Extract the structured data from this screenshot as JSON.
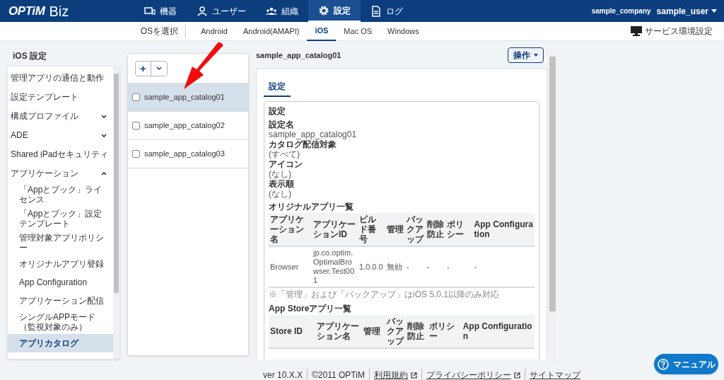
{
  "header": {
    "brand": "OPTiM",
    "product": "Biz",
    "nav": [
      {
        "label": "機器",
        "selected": false
      },
      {
        "label": "ユーザー",
        "selected": false
      },
      {
        "label": "組織",
        "selected": false
      },
      {
        "label": "設定",
        "selected": true
      },
      {
        "label": "ログ",
        "selected": false
      }
    ],
    "company": "sample_company",
    "user": "sample_user"
  },
  "os_bar": {
    "label": "OSを選択",
    "tabs": [
      {
        "label": "Android",
        "selected": false
      },
      {
        "label": "Android(AMAPI)",
        "selected": false
      },
      {
        "label": "iOS",
        "selected": true
      },
      {
        "label": "Mac OS",
        "selected": false
      },
      {
        "label": "Windows",
        "selected": false
      }
    ],
    "service_link": "サービス環境設定"
  },
  "sidebar": {
    "title": "iOS 設定",
    "items": [
      {
        "label": "管理アプリの通信と動作",
        "kind": "link",
        "selected": false
      },
      {
        "label": "設定テンプレート",
        "kind": "link",
        "selected": false
      },
      {
        "label": "構成プロファイル",
        "kind": "group",
        "expanded": false,
        "selected": false
      },
      {
        "label": "ADE",
        "kind": "group",
        "expanded": false,
        "selected": false
      },
      {
        "label": "Shared iPadセキュリティ",
        "kind": "link",
        "selected": false
      },
      {
        "label": "アプリケーション",
        "kind": "group",
        "expanded": true,
        "selected": false,
        "children": [
          {
            "label": "「Appとブック」ライセンス",
            "selected": false
          },
          {
            "label": "「Appとブック」設定テンプレート",
            "selected": false
          },
          {
            "label": "管理対象アプリポリシー",
            "selected": false
          },
          {
            "label": "オリジナルアプリ登録",
            "selected": false
          },
          {
            "label": "App Configuration",
            "selected": false
          },
          {
            "label": "アプリケーション配信",
            "selected": false
          },
          {
            "label": "シングルAPPモード（監視対象のみ）",
            "selected": false
          },
          {
            "label": "アプリカタログ",
            "selected": true
          }
        ]
      }
    ]
  },
  "catalog_list": {
    "add_button": "+",
    "items": [
      {
        "name": "sample_app_catalog01",
        "checked": false,
        "selected": true
      },
      {
        "name": "sample_app_catalog02",
        "checked": false,
        "selected": false
      },
      {
        "name": "sample_app_catalog03",
        "checked": false,
        "selected": false
      }
    ]
  },
  "detail": {
    "title": "sample_app_catalog01",
    "action_button": "操作",
    "tabs": [
      {
        "label": "設定",
        "selected": true
      }
    ],
    "section": {
      "heading": "設定",
      "fields": [
        {
          "label": "設定名",
          "value": "sample_app_catalog01"
        },
        {
          "label": "カタログ配信対象",
          "value": "(すべて)"
        },
        {
          "label": "アイコン",
          "value": "(なし)"
        },
        {
          "label": "表示順",
          "value": "(なし)"
        }
      ],
      "original_apps": {
        "heading": "オリジナルアプリ一覧",
        "columns": [
          "アプリケーション名",
          "アプリケーションID",
          "ビルド番号",
          "管理",
          "バックアップ",
          "削除防止",
          "ポリシー",
          "App Configuration"
        ],
        "rows": [
          [
            "Browser",
            "jp.co.optim.OptimalBrowser.Test001",
            "1.0.0.0",
            "無効",
            "-",
            "-",
            "-",
            "-"
          ]
        ],
        "note": "※「管理」および「バックアップ」はiOS 5.0.1以降のみ対応"
      },
      "appstore_apps": {
        "heading": "App Storeアプリ一覧",
        "columns": [
          "Store ID",
          "アプリケーション名",
          "管理",
          "バックアップ",
          "削除防止",
          "ポリシー",
          "App Configuration"
        ]
      }
    }
  },
  "footer": {
    "version": "ver 10.X.X",
    "copyright": "©2011 OPTiM",
    "links": [
      {
        "label": "利用規約",
        "external": true
      },
      {
        "label": "プライバシーポリシー",
        "external": true
      },
      {
        "label": "サイトマップ",
        "external": false
      }
    ]
  },
  "manual_button": "マニュアル"
}
